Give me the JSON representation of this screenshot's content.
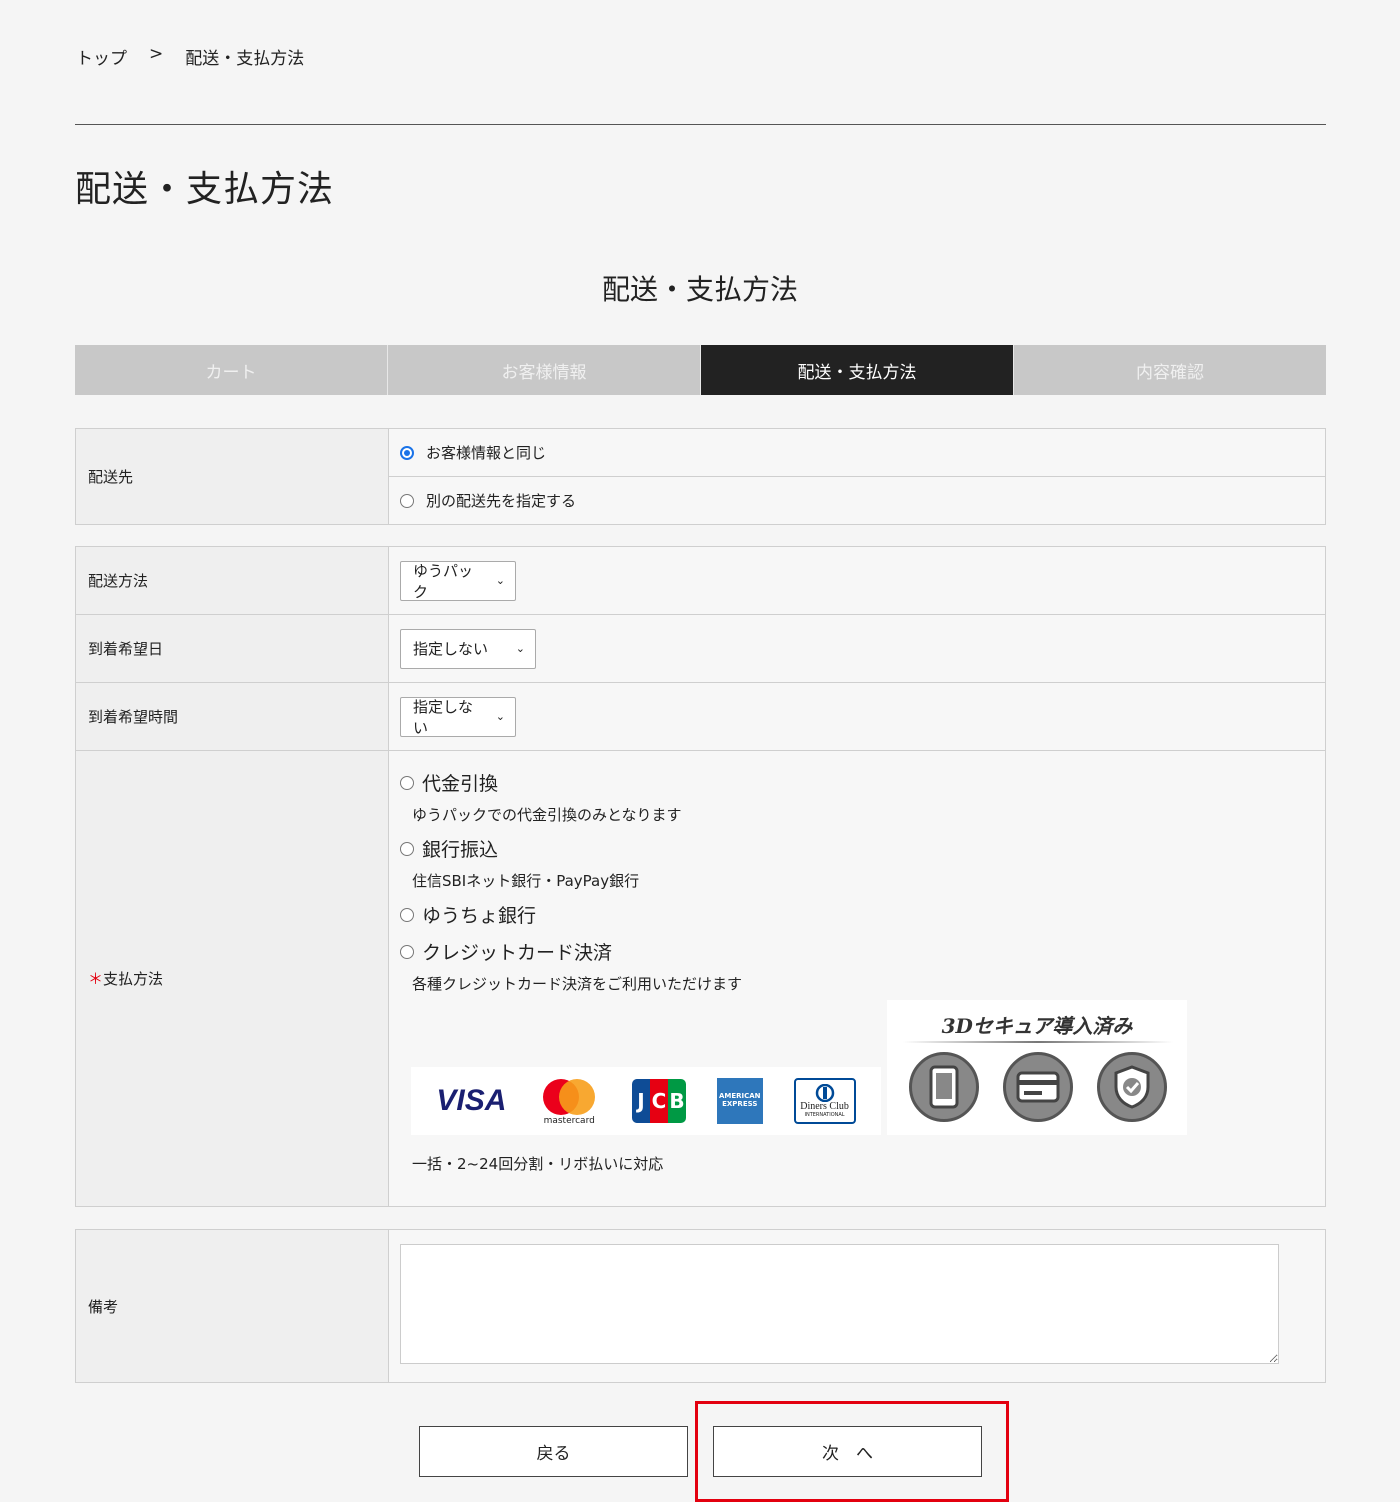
{
  "breadcrumb": {
    "home": "トップ",
    "sep": ">",
    "current": "配送・支払方法"
  },
  "page_title": "配送・支払方法",
  "section_title": "配送・支払方法",
  "steps": [
    "カート",
    "お客様情報",
    "配送・支払方法",
    "内容確認"
  ],
  "shipping_dest": {
    "label": "配送先",
    "options": [
      "お客様情報と同じ",
      "別の配送先を指定する"
    ],
    "selected": 0
  },
  "shipping_method": {
    "label": "配送方法",
    "value": "ゆうパック"
  },
  "arrival_date": {
    "label": "到着希望日",
    "value": "指定しない"
  },
  "arrival_time": {
    "label": "到着希望時間",
    "value": "指定しない"
  },
  "payment": {
    "required_mark": "＊",
    "label": "支払方法",
    "options": [
      {
        "name": "代金引換",
        "note": "ゆうパックでの代金引換のみとなります"
      },
      {
        "name": "銀行振込",
        "note": "住信SBIネット銀行・PayPay銀行"
      },
      {
        "name": "ゆうちょ銀行",
        "note": ""
      },
      {
        "name": "クレジットカード決済",
        "note": "各種クレジットカード決済をご利用いただけます"
      }
    ],
    "card_logos": [
      "VISA",
      "mastercard",
      "JCB",
      "AMERICAN EXPRESS",
      "Diners Club INTERNATIONAL"
    ],
    "secure_title": "3Dセキュア導入済み",
    "installments_note": "一括・2~24回分割・リボ払いに対応"
  },
  "remarks": {
    "label": "備考",
    "value": ""
  },
  "buttons": {
    "back": "戻る",
    "next": "次　へ"
  },
  "colors": {
    "accent": "#e3000f",
    "active_step": "#222222",
    "radio": "#1a73e8"
  }
}
